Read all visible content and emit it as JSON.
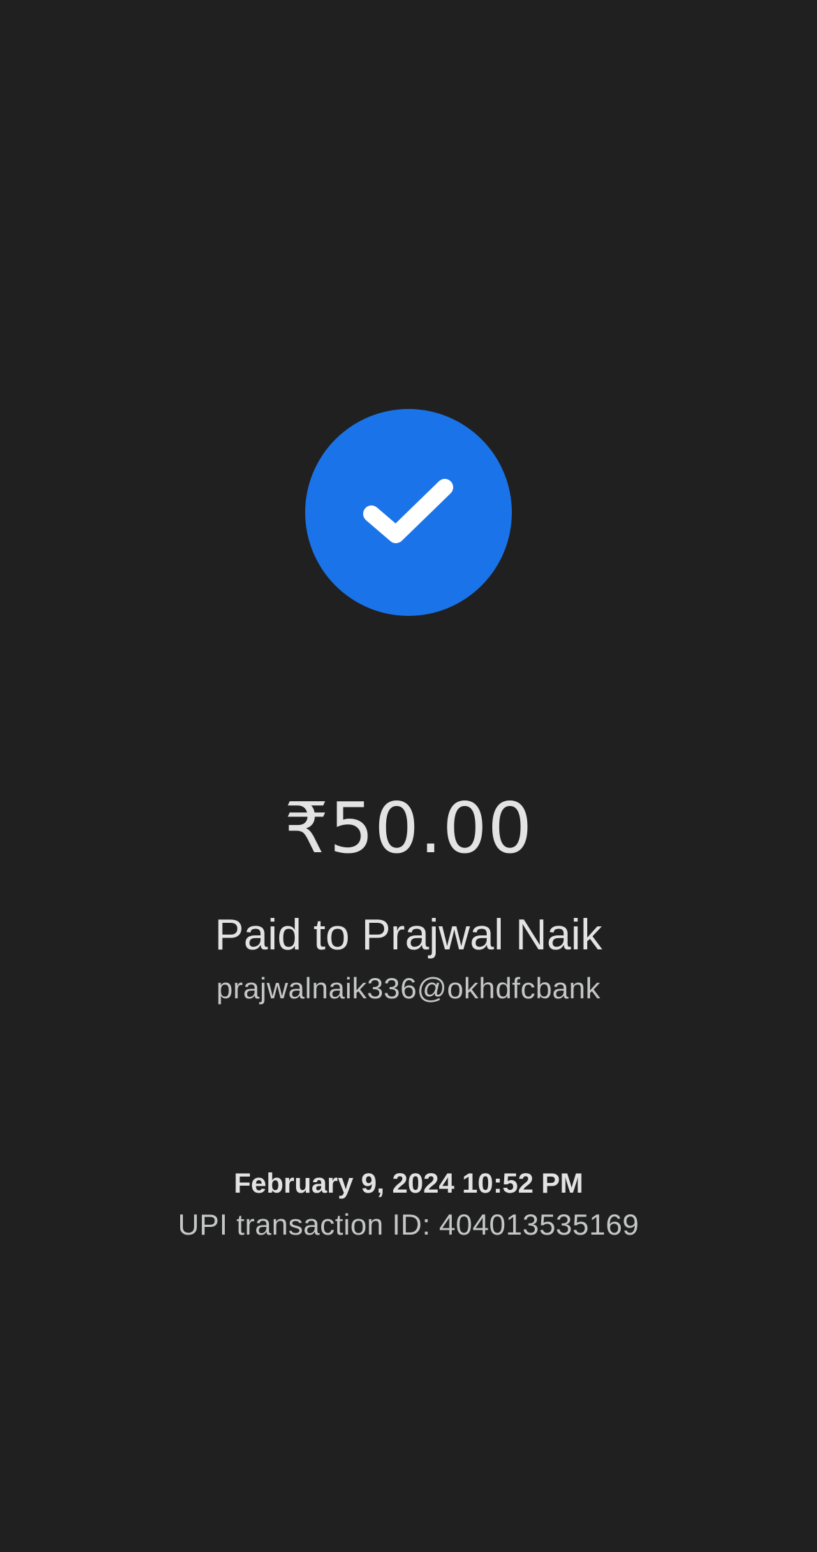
{
  "payment": {
    "status_icon": "check-circle-icon",
    "amount": "₹50.00",
    "payee_line": "Paid to Prajwal Naik",
    "payee_upi_id": "prajwalnaik336@okhdfcbank",
    "datetime": "February 9, 2024 10:52 PM",
    "transaction_id_line": "UPI transaction ID: 404013535169"
  },
  "colors": {
    "background": "#202020",
    "accent": "#1A73E8",
    "primary_text": "#E3E3E3",
    "secondary_text": "#C4C7C5"
  }
}
